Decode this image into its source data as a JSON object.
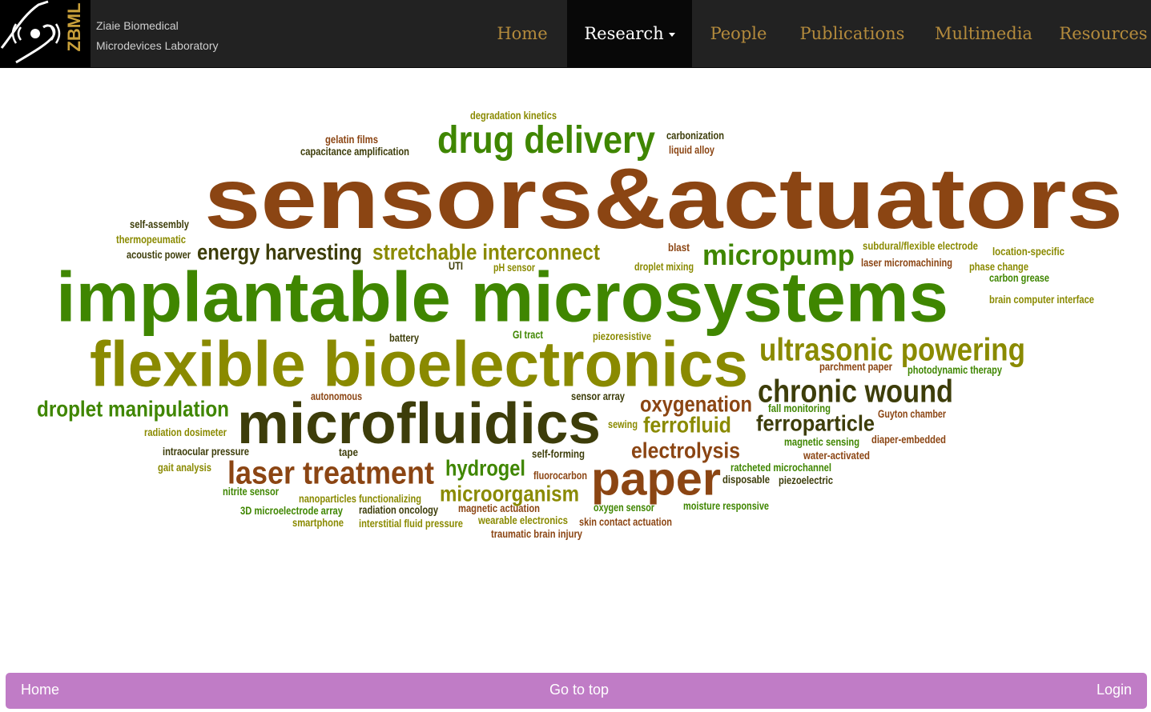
{
  "site": {
    "logo_text": "ZBML",
    "name_line1": "Ziaie Biomedical",
    "name_line2": "Microdevices Laboratory"
  },
  "nav": {
    "home": "Home",
    "research": "Research",
    "people": "People",
    "publications": "Publications",
    "multimedia": "Multimedia",
    "resources": "Resources"
  },
  "colors": {
    "brown": "#8b4513",
    "green": "#3f8600",
    "olive": "#8a8a00",
    "dark": "#3d3d0a",
    "footer": "#c07cc6",
    "nav_gold": "#b38a3c"
  },
  "wordcloud": {
    "words": [
      {
        "text": "sensors&actuators",
        "color": "brown"
      },
      {
        "text": "implantable microsystems",
        "color": "green"
      },
      {
        "text": "flexible bioelectronics",
        "color": "olive"
      },
      {
        "text": "microfluidics",
        "color": "dark"
      },
      {
        "text": "drug delivery",
        "color": "green"
      },
      {
        "text": "paper",
        "color": "brown"
      },
      {
        "text": "ultrasonic powering",
        "color": "olive"
      },
      {
        "text": "chronic wound",
        "color": "dark"
      },
      {
        "text": "laser treatment",
        "color": "brown"
      },
      {
        "text": "micropump",
        "color": "green"
      },
      {
        "text": "stretchable interconnect",
        "color": "olive"
      },
      {
        "text": "energy harvesting",
        "color": "dark"
      },
      {
        "text": "droplet manipulation",
        "color": "green"
      },
      {
        "text": "oxygenation",
        "color": "brown"
      },
      {
        "text": "ferrofluid",
        "color": "olive"
      },
      {
        "text": "ferroparticle",
        "color": "dark"
      },
      {
        "text": "electrolysis",
        "color": "brown"
      },
      {
        "text": "hydrogel",
        "color": "green"
      },
      {
        "text": "microorganism",
        "color": "olive"
      },
      {
        "text": "degradation kinetics",
        "color": "olive"
      },
      {
        "text": "gelatin films",
        "color": "brown"
      },
      {
        "text": "capacitance amplification",
        "color": "dark"
      },
      {
        "text": "carbonization",
        "color": "dark"
      },
      {
        "text": "liquid alloy",
        "color": "brown"
      },
      {
        "text": "self-assembly",
        "color": "dark"
      },
      {
        "text": "thermopeumatic",
        "color": "olive"
      },
      {
        "text": "acoustic power",
        "color": "dark"
      },
      {
        "text": "UTI",
        "color": "dark"
      },
      {
        "text": "pH sensor",
        "color": "olive"
      },
      {
        "text": "blast",
        "color": "brown"
      },
      {
        "text": "droplet mixing",
        "color": "olive"
      },
      {
        "text": "subdural/flexible electrode",
        "color": "olive"
      },
      {
        "text": "location-specific",
        "color": "olive"
      },
      {
        "text": "laser micromachining",
        "color": "brown"
      },
      {
        "text": "phase change",
        "color": "olive"
      },
      {
        "text": "carbon grease",
        "color": "green"
      },
      {
        "text": "brain computer interface",
        "color": "olive"
      },
      {
        "text": "battery",
        "color": "dark"
      },
      {
        "text": "GI tract",
        "color": "green"
      },
      {
        "text": "piezoresistive",
        "color": "olive"
      },
      {
        "text": "parchment paper",
        "color": "brown"
      },
      {
        "text": "photodynamic therapy",
        "color": "green"
      },
      {
        "text": "autonomous",
        "color": "brown"
      },
      {
        "text": "sensor array",
        "color": "dark"
      },
      {
        "text": "fall monitoring",
        "color": "green"
      },
      {
        "text": "Guyton chamber",
        "color": "brown"
      },
      {
        "text": "sewing",
        "color": "olive"
      },
      {
        "text": "radiation dosimeter",
        "color": "olive"
      },
      {
        "text": "magnetic sensing",
        "color": "green"
      },
      {
        "text": "diaper-embedded",
        "color": "brown"
      },
      {
        "text": "intraocular pressure",
        "color": "dark"
      },
      {
        "text": "tape",
        "color": "dark"
      },
      {
        "text": "self-forming",
        "color": "dark"
      },
      {
        "text": "water-activated",
        "color": "brown"
      },
      {
        "text": "gait analysis",
        "color": "olive"
      },
      {
        "text": "ratcheted microchannel",
        "color": "green"
      },
      {
        "text": "fluorocarbon",
        "color": "brown"
      },
      {
        "text": "disposable",
        "color": "dark"
      },
      {
        "text": "piezoelectric",
        "color": "dark"
      },
      {
        "text": "nitrite sensor",
        "color": "green"
      },
      {
        "text": "nanoparticles functionalizing",
        "color": "olive"
      },
      {
        "text": "3D microelectrode array",
        "color": "green"
      },
      {
        "text": "radiation oncology",
        "color": "dark"
      },
      {
        "text": "magnetic actuation",
        "color": "brown"
      },
      {
        "text": "oxygen sensor",
        "color": "green"
      },
      {
        "text": "moisture responsive",
        "color": "green"
      },
      {
        "text": "smartphone",
        "color": "olive"
      },
      {
        "text": "interstitial fluid pressure",
        "color": "olive"
      },
      {
        "text": "wearable electronics",
        "color": "olive"
      },
      {
        "text": "skin contact actuation",
        "color": "brown"
      },
      {
        "text": "traumatic brain injury",
        "color": "brown"
      }
    ]
  },
  "footer": {
    "home": "Home",
    "top": "Go to top",
    "login": "Login"
  }
}
